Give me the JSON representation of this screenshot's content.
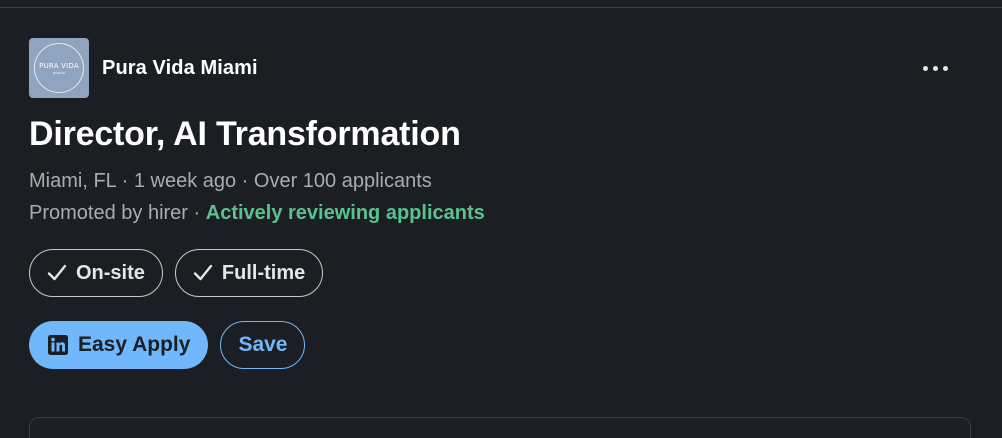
{
  "company": {
    "name": "Pura Vida Miami",
    "logo_text": "PURA VIDA",
    "logo_subtext": "miami"
  },
  "header": {
    "more_icon": "ellipsis-horizontal-icon"
  },
  "job": {
    "title": "Director, AI Transformation",
    "location": "Miami, FL",
    "posted": "1 week ago",
    "applicants": "Over 100 applicants",
    "separator": " · ",
    "promoted": "Promoted by hirer",
    "status": "Actively reviewing applicants",
    "status_color": "#5ac28e"
  },
  "chips": [
    {
      "label": "On-site",
      "icon": "checkmark-icon"
    },
    {
      "label": "Full-time",
      "icon": "checkmark-icon"
    }
  ],
  "actions": {
    "apply_label": "Easy Apply",
    "apply_icon": "linkedin-icon",
    "save_label": "Save",
    "accent_color": "#71b7fb"
  }
}
